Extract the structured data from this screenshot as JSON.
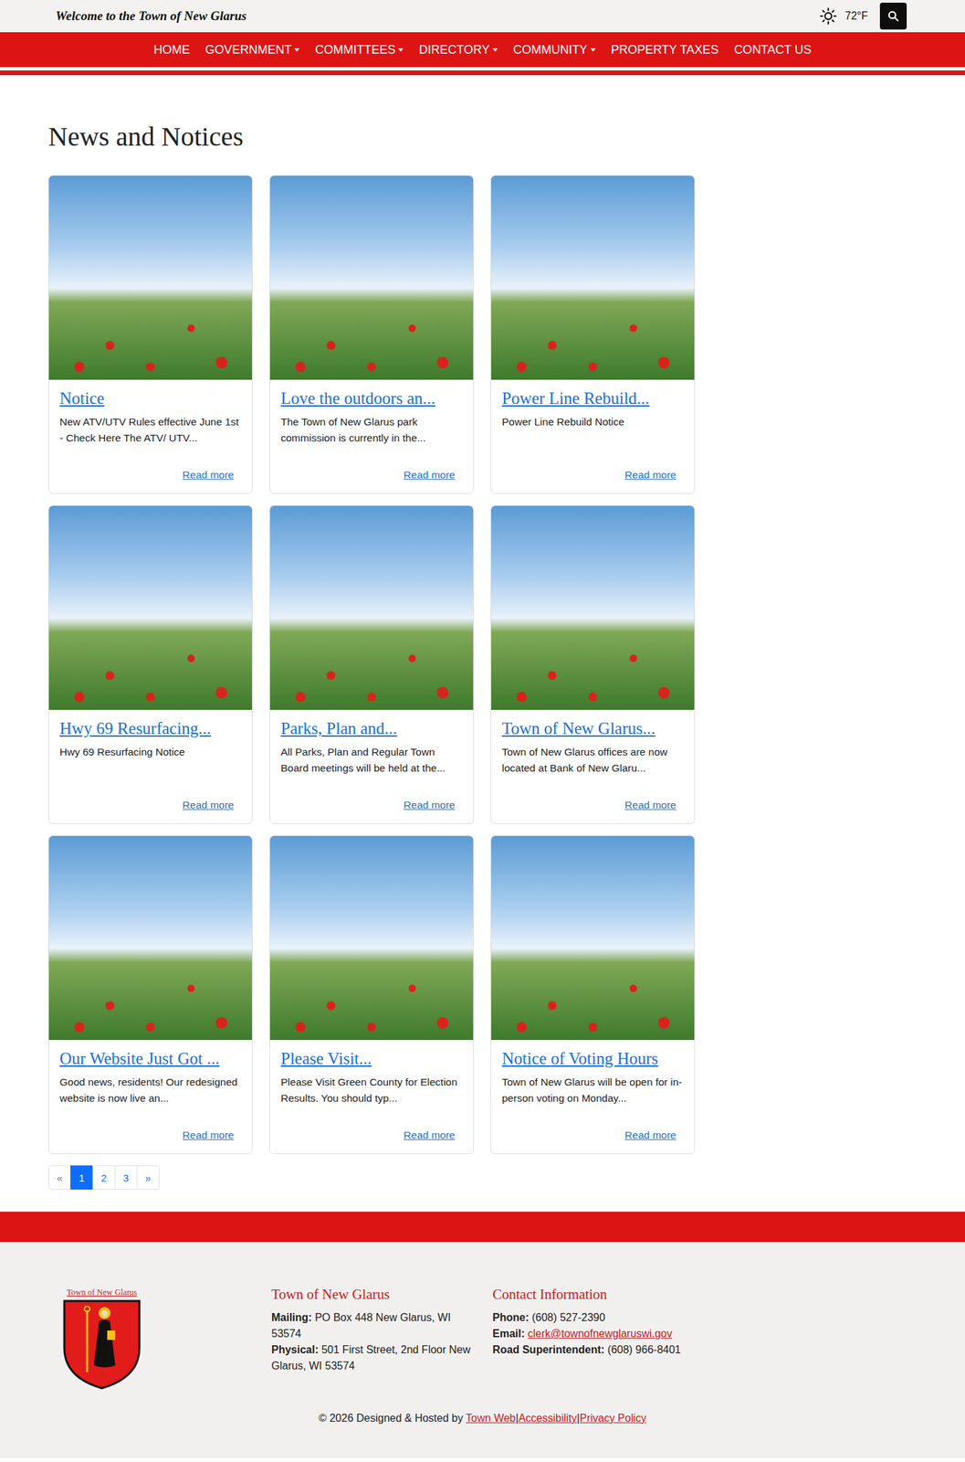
{
  "topbar": {
    "title": "Welcome to the Town of New Glarus",
    "temperature": "72°F"
  },
  "nav": [
    {
      "label": "HOME",
      "dropdown": false
    },
    {
      "label": "GOVERNMENT",
      "dropdown": true
    },
    {
      "label": "COMMITTEES",
      "dropdown": true
    },
    {
      "label": "DIRECTORY",
      "dropdown": true
    },
    {
      "label": "COMMUNITY",
      "dropdown": true
    },
    {
      "label": "PROPERTY TAXES",
      "dropdown": false
    },
    {
      "label": "CONTACT US",
      "dropdown": false
    }
  ],
  "page_title": "News and Notices",
  "cards": [
    {
      "title": "Notice",
      "excerpt": "New ATV/UTV Rules effective June 1st - Check Here   The ATV/ UTV...",
      "link": "Read more"
    },
    {
      "title": "Love the outdoors an...",
      "excerpt": "The Town of New Glarus park commission is currently in the...",
      "link": "Read more"
    },
    {
      "title": "Power Line Rebuild...",
      "excerpt": "Power Line Rebuild Notice",
      "link": "Read more"
    },
    {
      "title": "Hwy 69 Resurfacing...",
      "excerpt": "Hwy 69 Resurfacing Notice",
      "link": "Read more"
    },
    {
      "title": "Parks, Plan and...",
      "excerpt": "All Parks, Plan and Regular Town Board meetings will be held at the...",
      "link": "Read more"
    },
    {
      "title": "Town of New Glarus...",
      "excerpt": "Town of New Glarus offices are now located at Bank of New Glaru...",
      "link": "Read more"
    },
    {
      "title": "Our Website Just Got ...",
      "excerpt": "Good news, residents! Our redesigned website is now live an...",
      "link": "Read more"
    },
    {
      "title": "Please Visit...",
      "excerpt": "Please Visit Green County for Election Results.   You should typ...",
      "link": "Read more"
    },
    {
      "title": "Notice of Voting Hours",
      "excerpt": "Town of New Glarus will be open for in-person voting on Monday...",
      "link": "Read more"
    }
  ],
  "pagination": [
    {
      "label": "«",
      "selected": false,
      "disabled": true
    },
    {
      "label": "1",
      "selected": true,
      "disabled": false
    },
    {
      "label": "2",
      "selected": false,
      "disabled": false
    },
    {
      "label": "3",
      "selected": false,
      "disabled": false
    },
    {
      "label": "»",
      "selected": false,
      "disabled": false
    }
  ],
  "footer": {
    "logo_text": "Town of New Glarus",
    "address": {
      "heading": "Town of New Glarus",
      "lines": [
        {
          "label": "Mailing:",
          "value": "PO Box 448 New Glarus, WI 53574"
        },
        {
          "label": "Physical:",
          "value": "501 First Street, 2nd Floor New Glarus, WI 53574"
        }
      ]
    },
    "contact": {
      "heading": "Contact Information",
      "lines": [
        {
          "label": "Phone:",
          "value": "(608) 527-2390",
          "link": false
        },
        {
          "label": "Email:",
          "value": "clerk@townofnewglaruswi.gov",
          "link": true
        },
        {
          "label": "Road Superintendent:",
          "value": "(608) 966-8401",
          "link": false
        }
      ]
    },
    "copyright": "© 2026 Designed & Hosted by",
    "links": [
      "Town Web",
      "Accessibility",
      "Privacy Policy"
    ],
    "separator": "|"
  }
}
